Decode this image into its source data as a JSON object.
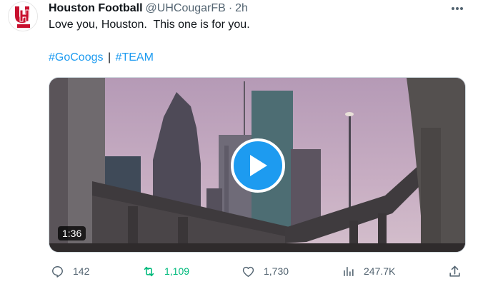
{
  "tweet": {
    "author_name": "Houston Football",
    "author_handle": "@UHCougarFB",
    "separator": "·",
    "timestamp": "2h",
    "text": "Love you, Houston.  This one is for you.",
    "hashtags": [
      "#GoCoogs",
      "#TEAM"
    ],
    "hashtag_separator": "|",
    "avatar": {
      "logo_text": "UH",
      "icon": "university-logo-icon",
      "color": "#c8102e"
    },
    "more_icon": "more-horizontal-icon"
  },
  "media": {
    "type": "video",
    "duration": "1:36",
    "play_icon": "play-icon",
    "accent": "#1d9bf0"
  },
  "actions": {
    "reply": {
      "icon": "reply-icon",
      "count": "142"
    },
    "retweet": {
      "icon": "retweet-icon",
      "count": "1,109",
      "color": "#00ba7c"
    },
    "like": {
      "icon": "heart-icon",
      "count": "1,730"
    },
    "views": {
      "icon": "views-icon",
      "count": "247.7K"
    },
    "share": {
      "icon": "share-icon"
    }
  },
  "colors": {
    "text": "#0f1419",
    "muted": "#536471",
    "link": "#1d9bf0"
  }
}
